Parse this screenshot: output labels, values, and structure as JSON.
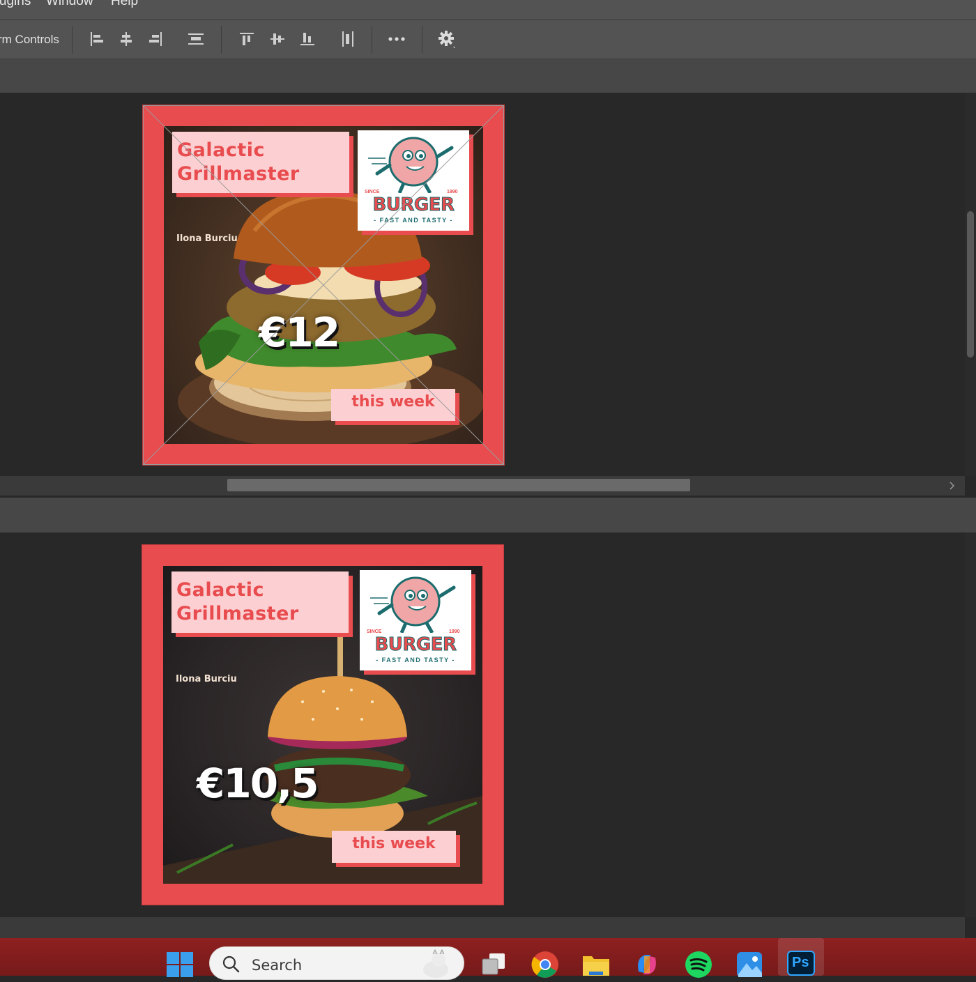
{
  "menubar": {
    "items": [
      "Plugins",
      "Window",
      "Help"
    ]
  },
  "options_bar": {
    "label": "Transform Controls",
    "tools": [
      "align-left-icon",
      "align-horizontal-center-icon",
      "align-right-icon",
      "distribute-horizontal-icon",
      "align-top-icon",
      "align-vertical-center-icon",
      "align-bottom-icon",
      "distribute-vertical-icon",
      "more-options-icon",
      "settings-icon"
    ]
  },
  "documents": [
    {
      "poster": {
        "title": "Galactic\nGrillmaster",
        "author": "Ilona Burciu",
        "price": "€12",
        "tagline": "this week",
        "logo": {
          "since": "SINCE",
          "year": "1990",
          "word": "BURGER",
          "tag": "- FAST AND TASTY -"
        },
        "transform_guides": true
      }
    },
    {
      "poster": {
        "title": "Galactic\nGrillmaster",
        "author": "Ilona Burciu",
        "price": "€10,5",
        "tagline": "this week",
        "logo": {
          "since": "SINCE",
          "year": "1990",
          "word": "BURGER",
          "tag": "- FAST AND TASTY -"
        },
        "transform_guides": false
      }
    }
  ],
  "taskbar": {
    "search_placeholder": "Search",
    "apps": [
      "windows-start-icon",
      "task-view-icon",
      "chrome-icon",
      "file-explorer-icon",
      "copilot-icon",
      "spotify-icon",
      "photos-icon",
      "photoshop-icon"
    ],
    "photoshop_label": "Ps"
  },
  "colors": {
    "poster_red": "#e84c4f",
    "poster_pink": "#fcd0d2",
    "logo_teal": "#1c6c6e",
    "taskbar": "#821c1c"
  }
}
